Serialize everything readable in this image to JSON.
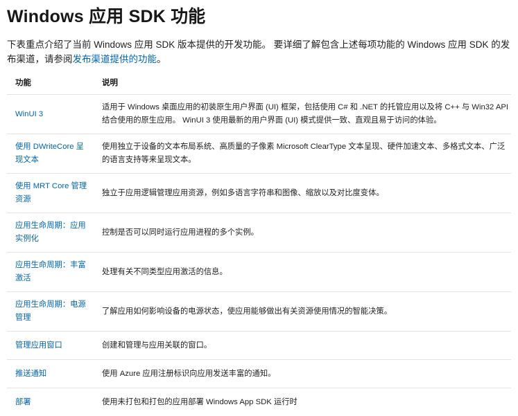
{
  "title": "Windows 应用 SDK 功能",
  "intro": {
    "text": "下表重点介绍了当前 Windows 应用 SDK 版本提供的开发功能。 要详细了解包含上述每项功能的 Windows 应用 SDK 的发布渠道，请参阅",
    "link_label": "发布渠道提供的功能",
    "suffix": "。"
  },
  "table": {
    "headers": {
      "feature": "功能",
      "description": "说明"
    },
    "rows": [
      {
        "feature": "WinUI 3",
        "description": "适用于 Windows 桌面应用的初装原生用户界面 (UI) 框架，包括使用 C# 和 .NET 的托管应用以及将 C++ 与 Win32 API 结合使用的原生应用。 WinUI 3 使用最新的用户界面 (UI) 模式提供一致、直观且易于访问的体验。"
      },
      {
        "feature": "使用 DWriteCore 呈现文本",
        "description": "使用独立于设备的文本布局系统、高质量的子像素 Microsoft ClearType 文本呈现、硬件加速文本、多格式文本、广泛的语言支持等来呈现文本。"
      },
      {
        "feature": "使用 MRT Core 管理资源",
        "description": "独立于应用逻辑管理应用资源，例如多语言字符串和图像、缩放以及对比度变体。"
      },
      {
        "feature": "应用生命周期：应用实例化",
        "description": "控制是否可以同时运行应用进程的多个实例。"
      },
      {
        "feature": "应用生命周期：丰富激活",
        "description": "处理有关不同类型应用激活的信息。"
      },
      {
        "feature": "应用生命周期：电源管理",
        "description": "了解应用如何影响设备的电源状态，使应用能够做出有关资源使用情况的智能决策。"
      },
      {
        "feature": "管理应用窗口",
        "description": "创建和管理与应用关联的窗口。"
      },
      {
        "feature": "推送通知",
        "description": "使用 Azure 应用注册标识向应用发送丰富的通知。"
      },
      {
        "feature": "部署",
        "description": "使用未打包和打包的应用部署 Windows App SDK 运行时"
      }
    ]
  },
  "colors": {
    "link": "#0065b3",
    "text": "#1f1f1f",
    "row_divider": "#e3e3e3"
  }
}
